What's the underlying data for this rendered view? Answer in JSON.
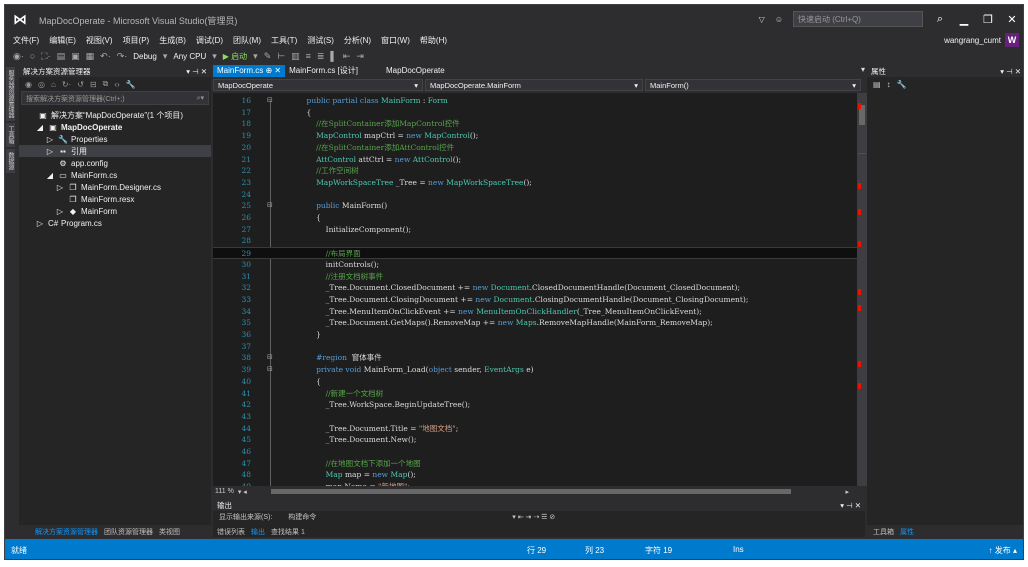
{
  "app": {
    "title": "MapDocOperate - Microsoft Visual Studio(管理员)",
    "quick_launch_placeholder": "快速启动 (Ctrl+Q)",
    "user": "wangrang_cumt",
    "user_badge": "W",
    "accent_color": "#007acc"
  },
  "menu": [
    "文件(F)",
    "编辑(E)",
    "视图(V)",
    "项目(P)",
    "生成(B)",
    "调试(D)",
    "团队(M)",
    "工具(T)",
    "测试(S)",
    "分析(N)",
    "窗口(W)",
    "帮助(H)"
  ],
  "toolbar": {
    "config": "Debug",
    "platform": "Any CPU",
    "start_label": "▶ 启动"
  },
  "left_vertical_tabs": [
    "服务器资源管理器",
    "工具箱",
    "数据源"
  ],
  "solution_explorer": {
    "title": "解决方案资源管理器",
    "search_placeholder": "搜索解决方案资源管理器(Ctrl+;)",
    "items": [
      {
        "label": "解决方案“MapDocOperate”(1 个项目)",
        "icon": "solution-icon",
        "glyph": "▣",
        "arrow": "",
        "depth": 0,
        "selected": false
      },
      {
        "label": "MapDocOperate",
        "icon": "csharp-project-icon",
        "glyph": "▣",
        "arrow": "◢",
        "depth": 1,
        "selected": false
      },
      {
        "label": "Properties",
        "icon": "wrench-icon",
        "glyph": "🔧",
        "arrow": "▷",
        "depth": 2,
        "selected": false
      },
      {
        "label": "引用",
        "icon": "references-icon",
        "glyph": "▪▪",
        "arrow": "▷",
        "depth": 2,
        "selected": true
      },
      {
        "label": "app.config",
        "icon": "config-file-icon",
        "glyph": "⚙",
        "arrow": "",
        "depth": 2,
        "selected": false
      },
      {
        "label": "MainForm.cs",
        "icon": "form-icon",
        "glyph": "▭",
        "arrow": "◢",
        "depth": 2,
        "selected": false
      },
      {
        "label": "MainForm.Designer.cs",
        "icon": "csharp-file-icon",
        "glyph": "❐",
        "arrow": "▷",
        "depth": 3,
        "selected": false
      },
      {
        "label": "MainForm.resx",
        "icon": "resx-file-icon",
        "glyph": "❐",
        "arrow": "",
        "depth": 3,
        "selected": false
      },
      {
        "label": "MainForm",
        "icon": "class-icon",
        "glyph": "◆",
        "arrow": "▷",
        "depth": 3,
        "selected": false
      },
      {
        "label": "Program.cs",
        "icon": "csharp-file-icon",
        "glyph": "C#",
        "arrow": "▷",
        "depth": 1,
        "selected": false
      }
    ],
    "bottom_tabs": [
      "解决方案资源管理器",
      "团队资源管理器",
      "类视图"
    ]
  },
  "editor": {
    "tabs": [
      "MainForm.cs",
      "MainForm.cs [设计]"
    ],
    "active_tab": "MainForm.cs",
    "tab_pin": "⊕ ✕",
    "project_label": "MapDocOperate",
    "nav_project": "MapDocOperate",
    "nav_class": "MapDocOperate.MainForm",
    "nav_member": "MainForm()",
    "zoom": "111 %",
    "current_line": 29,
    "lines": [
      {
        "n": 16,
        "code": "    <span class=\"kw\">public partial class</span> <span class=\"ty\">MainForm</span> : <span class=\"ty\">Form</span>"
      },
      {
        "n": 17,
        "code": "    {"
      },
      {
        "n": 18,
        "code": "        <span class=\"cm\">//在SplitContainer添加MapControl控件</span>"
      },
      {
        "n": 19,
        "code": "        <span class=\"ty\">MapControl</span> mapCtrl = <span class=\"kw\">new</span> <span class=\"ty\">MapControl</span>();"
      },
      {
        "n": 20,
        "code": "        <span class=\"cm\">//在SplitContainer添加AttControl控件</span>"
      },
      {
        "n": 21,
        "code": "        <span class=\"ty\">AttControl</span> attCtrl = <span class=\"kw\">new</span> <span class=\"ty\">AttControl</span>();"
      },
      {
        "n": 22,
        "code": "        <span class=\"cm\">//工作空间树</span>"
      },
      {
        "n": 23,
        "code": "        <span class=\"ty\">MapWorkSpaceTree</span> _Tree = <span class=\"kw\">new</span> <span class=\"ty\">MapWorkSpaceTree</span>();"
      },
      {
        "n": 24,
        "code": ""
      },
      {
        "n": 25,
        "code": "        <span class=\"kw\">public</span> MainForm()"
      },
      {
        "n": 26,
        "code": "        {"
      },
      {
        "n": 27,
        "code": "            InitializeComponent();"
      },
      {
        "n": 28,
        "code": ""
      },
      {
        "n": 29,
        "code": "            <span class=\"cm\">//布局界面</span>"
      },
      {
        "n": 30,
        "code": "            initControls();"
      },
      {
        "n": 31,
        "code": "            <span class=\"cm\">//注册文档树事件</span>"
      },
      {
        "n": 32,
        "code": "            _Tree.Document.ClosedDocument += <span class=\"kw\">new</span> <span class=\"ty\">Document</span>.ClosedDocumentHandle(Document_ClosedDocument);"
      },
      {
        "n": 33,
        "code": "            _Tree.Document.ClosingDocument += <span class=\"kw\">new</span> <span class=\"ty\">Document</span>.ClosingDocumentHandle(Document_ClosingDocument);"
      },
      {
        "n": 34,
        "code": "            _Tree.MenuItemOnClickEvent += <span class=\"kw\">new</span> <span class=\"ty\">MenuItemOnClickHandler</span>(_Tree_MenuItemOnClickEvent);"
      },
      {
        "n": 35,
        "code": "            _Tree.Document.GetMaps().RemoveMap += <span class=\"kw\">new</span> <span class=\"ty\">Maps</span>.RemoveMapHandle(MainForm_RemoveMap);"
      },
      {
        "n": 36,
        "code": "        }"
      },
      {
        "n": 37,
        "code": ""
      },
      {
        "n": 38,
        "code": "        <span class=\"kw\">#region</span>  窗体事件"
      },
      {
        "n": 39,
        "code": "        <span class=\"kw\">private void</span> MainForm_Load(<span class=\"kw\">object</span> sender, <span class=\"ty\">EventArgs</span> e)"
      },
      {
        "n": 40,
        "code": "        {"
      },
      {
        "n": 41,
        "code": "            <span class=\"cm\">//新建一个文档树</span>"
      },
      {
        "n": 42,
        "code": "            _Tree.WorkSpace.BeginUpdateTree();"
      },
      {
        "n": 43,
        "code": ""
      },
      {
        "n": 44,
        "code": "            _Tree.Document.Title = <span class=\"st\">\"地图文档\"</span>;"
      },
      {
        "n": 45,
        "code": "            _Tree.Document.New();"
      },
      {
        "n": 46,
        "code": ""
      },
      {
        "n": 47,
        "code": "            <span class=\"cm\">//在地图文档下添加一个地图</span>"
      },
      {
        "n": 48,
        "code": "            <span class=\"ty\">Map</span> map = <span class=\"kw\">new</span> <span class=\"ty\">Map</span>();"
      },
      {
        "n": 49,
        "code": "            map.Name = <span class=\"st\">\"新地图\"</span>;"
      }
    ]
  },
  "output": {
    "title": "输出",
    "source_label": "显示输出来源(S):",
    "source_value": "构建命令",
    "bottom_tabs": [
      "错误列表",
      "输出",
      "查找结果 1"
    ],
    "active_tab": "输出"
  },
  "properties": {
    "title": "属性",
    "bottom_tabs": [
      "工具箱",
      "属性"
    ],
    "active_tab": "属性"
  },
  "status": {
    "left": "就绪",
    "line": "行 29",
    "col": "列 23",
    "char": "字符 19",
    "mode": "Ins",
    "publish": "↑ 发布 ▴"
  }
}
